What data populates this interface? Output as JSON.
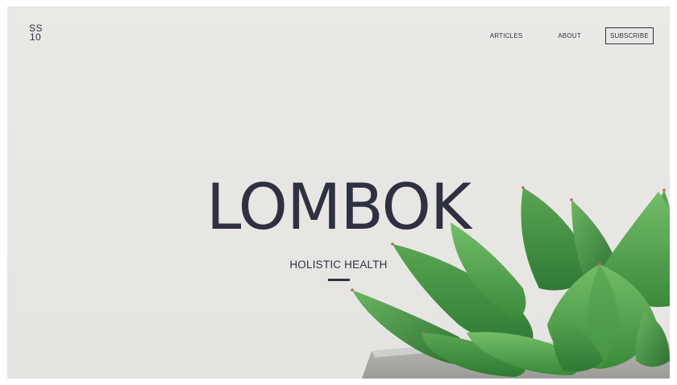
{
  "brand": {
    "logo_line1": "SS",
    "logo_line2": "10"
  },
  "nav": {
    "articles": "ARTICLES",
    "about": "ABOUT",
    "subscribe": "SUBSCRIBE"
  },
  "hero": {
    "title": "LOMBOK",
    "subtitle": "HOLISTIC HEALTH"
  },
  "colors": {
    "background": "#e9e7e4",
    "text": "#2f3142",
    "plant_green": "#3f8a3c"
  }
}
